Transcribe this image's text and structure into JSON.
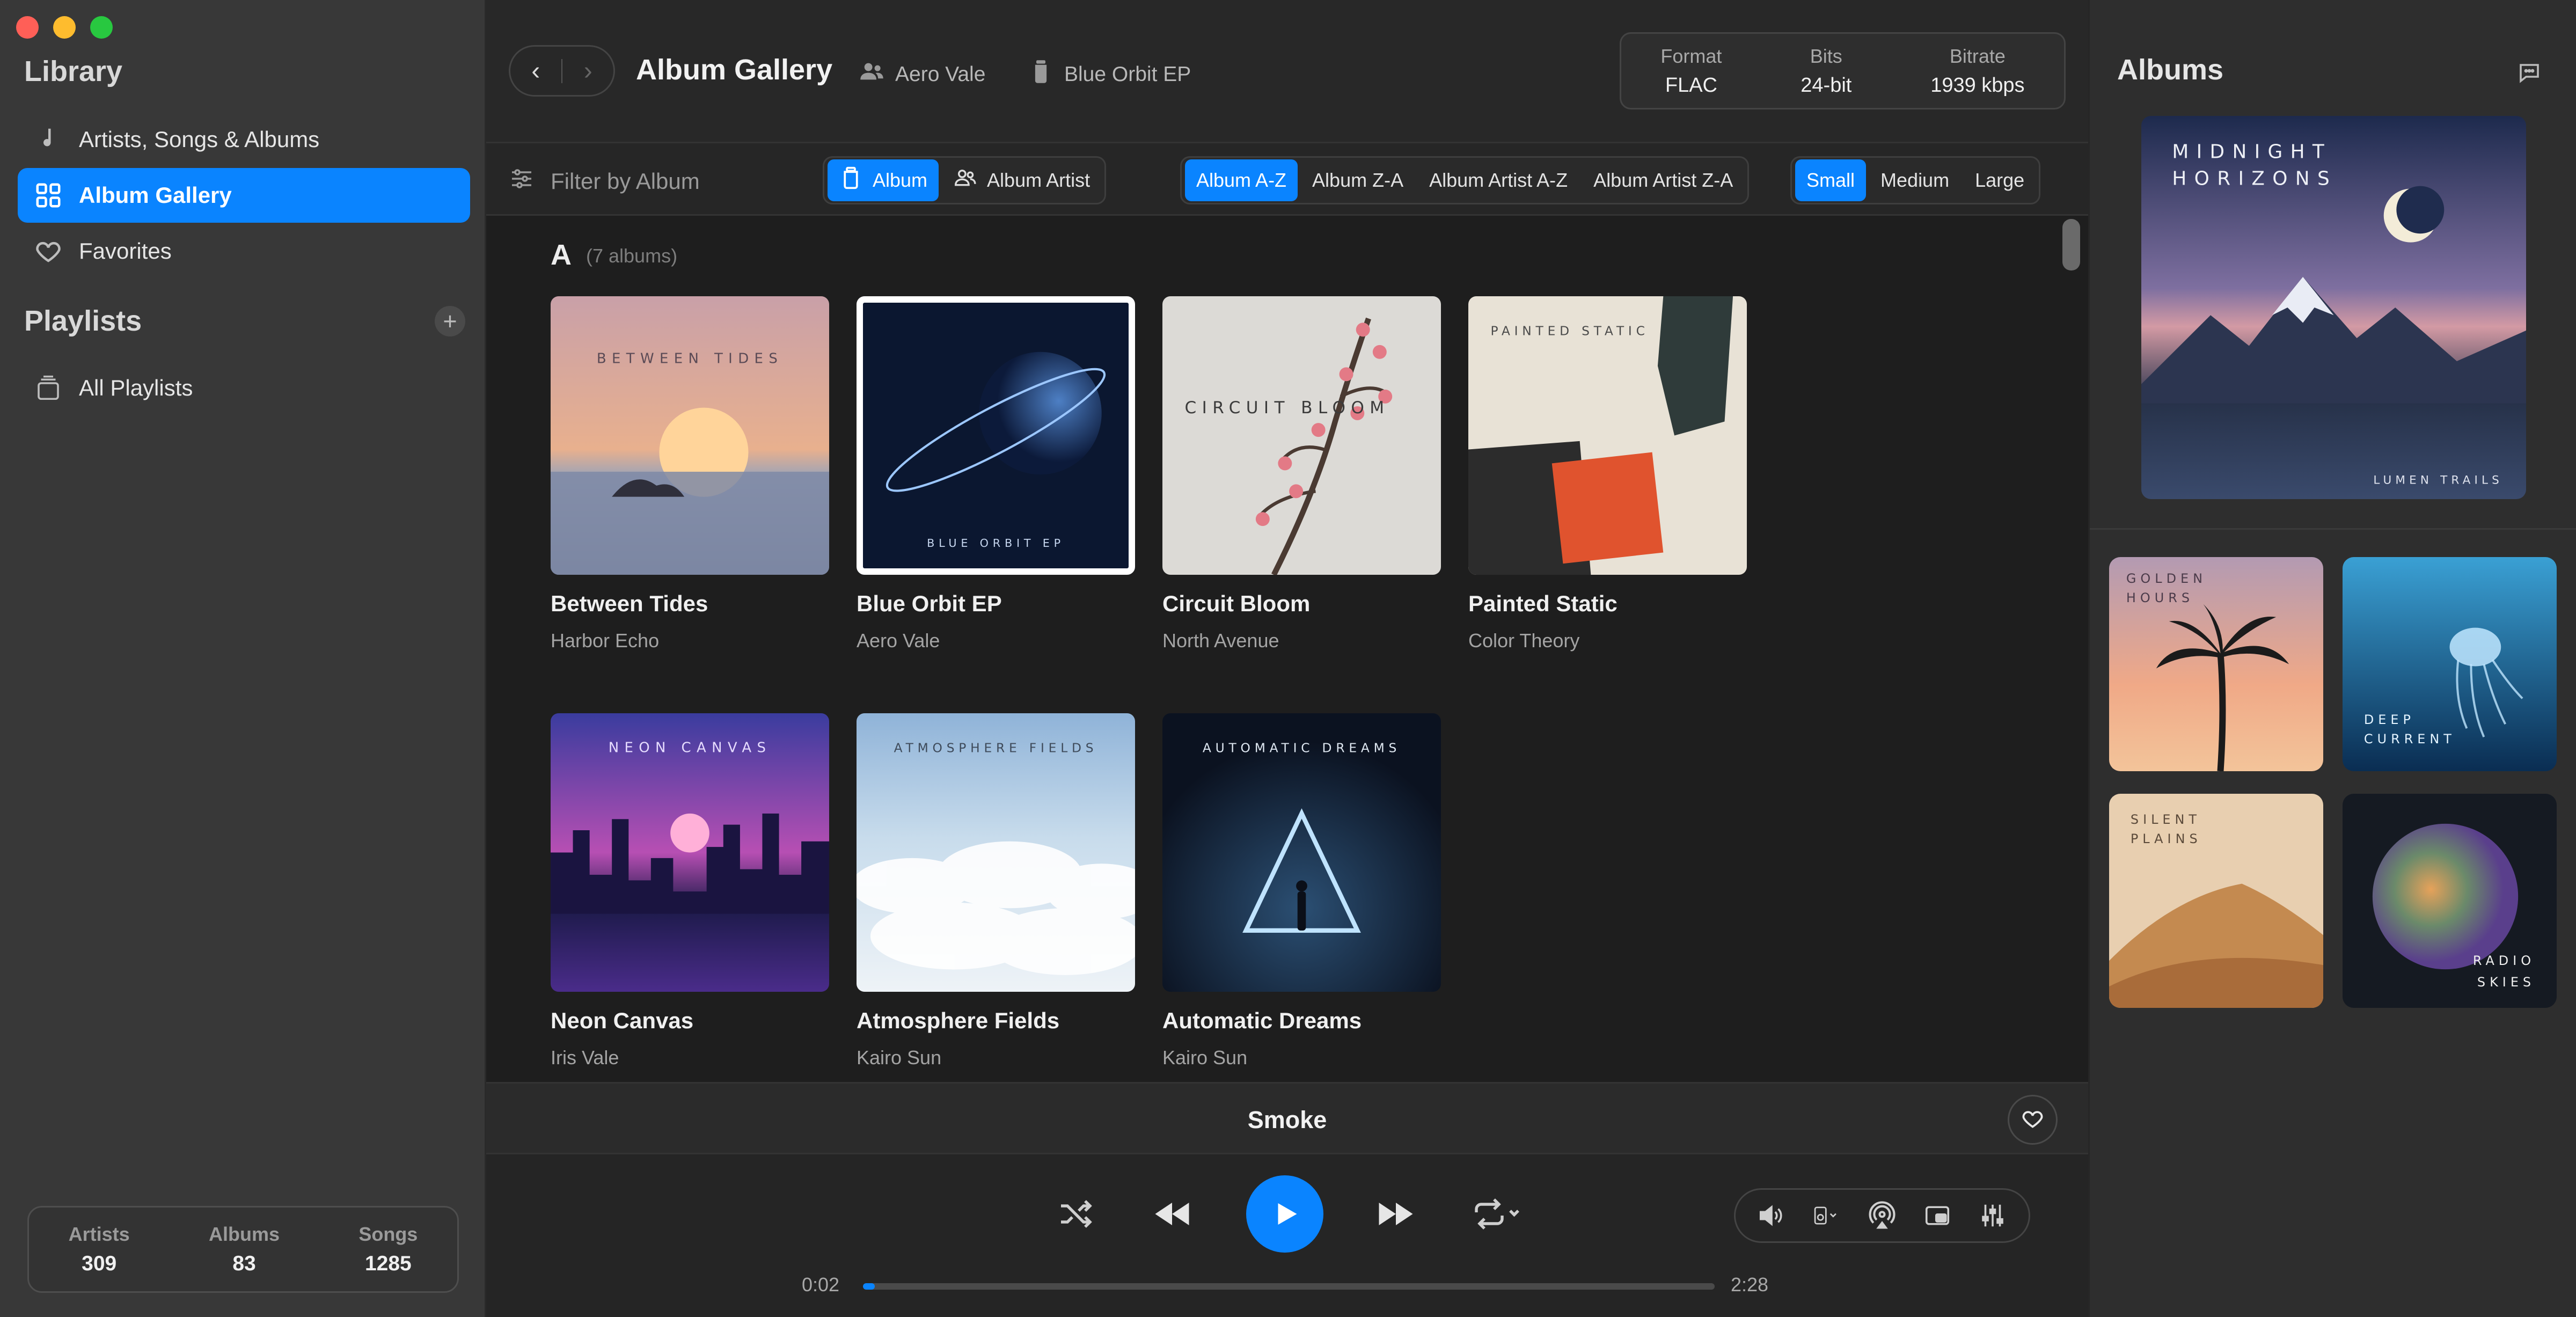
{
  "window": {
    "controls": [
      "close",
      "minimize",
      "zoom"
    ]
  },
  "sidebar": {
    "library_heading": "Library",
    "library_items": [
      {
        "label": "Artists, Songs & Albums",
        "icon": "music-note-icon",
        "active": false
      },
      {
        "label": "Album Gallery",
        "icon": "grid-icon",
        "active": true
      },
      {
        "label": "Favorites",
        "icon": "heart-icon",
        "active": false
      }
    ],
    "playlists_heading": "Playlists",
    "add_playlist_label": "+",
    "playlist_items": [
      {
        "label": "All Playlists",
        "icon": "stack-icon"
      }
    ],
    "stats": [
      {
        "label": "Artists",
        "value": "309"
      },
      {
        "label": "Albums",
        "value": "83"
      },
      {
        "label": "Songs",
        "value": "1285"
      }
    ]
  },
  "header": {
    "back_label": "‹",
    "forward_label": "›",
    "title": "Album Gallery",
    "artist": "Aero Vale",
    "album": "Blue Orbit EP",
    "format": [
      {
        "label": "Format",
        "value": "FLAC"
      },
      {
        "label": "Bits",
        "value": "24-bit"
      },
      {
        "label": "Bitrate",
        "value": "1939 kbps"
      }
    ]
  },
  "toolbar": {
    "filter_placeholder": "Filter by Album",
    "group_by": [
      {
        "label": "Album",
        "on": true
      },
      {
        "label": "Album Artist",
        "on": false
      }
    ],
    "sort": [
      {
        "label": "Album A-Z",
        "on": true
      },
      {
        "label": "Album Z-A",
        "on": false
      },
      {
        "label": "Album Artist A-Z",
        "on": false
      },
      {
        "label": "Album Artist Z-A",
        "on": false
      }
    ],
    "size": [
      {
        "label": "Small",
        "on": true
      },
      {
        "label": "Medium",
        "on": false
      },
      {
        "label": "Large",
        "on": false
      }
    ]
  },
  "gallery": {
    "section_letter": "A",
    "section_count": "(7 albums)",
    "albums": [
      {
        "title": "Between Tides",
        "artist": "Harbor Echo",
        "cover_text": "BETWEEN TIDES",
        "selected": false
      },
      {
        "title": "Blue Orbit EP",
        "artist": "Aero Vale",
        "cover_text": "BLUE ORBIT EP",
        "selected": true
      },
      {
        "title": "Circuit Bloom",
        "artist": "North Avenue",
        "cover_text": "CIRCUIT BLOOM",
        "selected": false
      },
      {
        "title": "Painted Static",
        "artist": "Color Theory",
        "cover_text": "PAINTED STATIC",
        "selected": false
      },
      {
        "title": "Neon Canvas",
        "artist": "Iris Vale",
        "cover_text": "NEON CANVAS",
        "selected": false
      },
      {
        "title": "Atmosphere Fields",
        "artist": "Kairo Sun",
        "cover_text": "ATMOSPHERE FIELDS",
        "selected": false
      },
      {
        "title": "Automatic Dreams",
        "artist": "Kairo Sun",
        "cover_text": "AUTOMATIC DREAMS",
        "selected": false
      }
    ]
  },
  "now_playing": {
    "track": "Smoke",
    "elapsed": "0:02",
    "duration": "2:28",
    "progress_fraction": 0.014
  },
  "right_panel": {
    "title": "Albums",
    "featured": {
      "line1": "MIDNIGHT",
      "line2": "HORIZONS",
      "artist": "LUMEN TRAILS"
    },
    "tiles": [
      {
        "line1": "GOLDEN",
        "line2": "HOURS"
      },
      {
        "line1": "DEEP",
        "line2": "CURRENT"
      },
      {
        "line1": "SILENT",
        "line2": "PLAINS"
      },
      {
        "line1": "RADIO",
        "line2": "SKIES"
      }
    ]
  },
  "colors": {
    "accent": "#0a84ff",
    "sidebar_bg": "#383838",
    "main_bg": "#1e1e1e"
  }
}
